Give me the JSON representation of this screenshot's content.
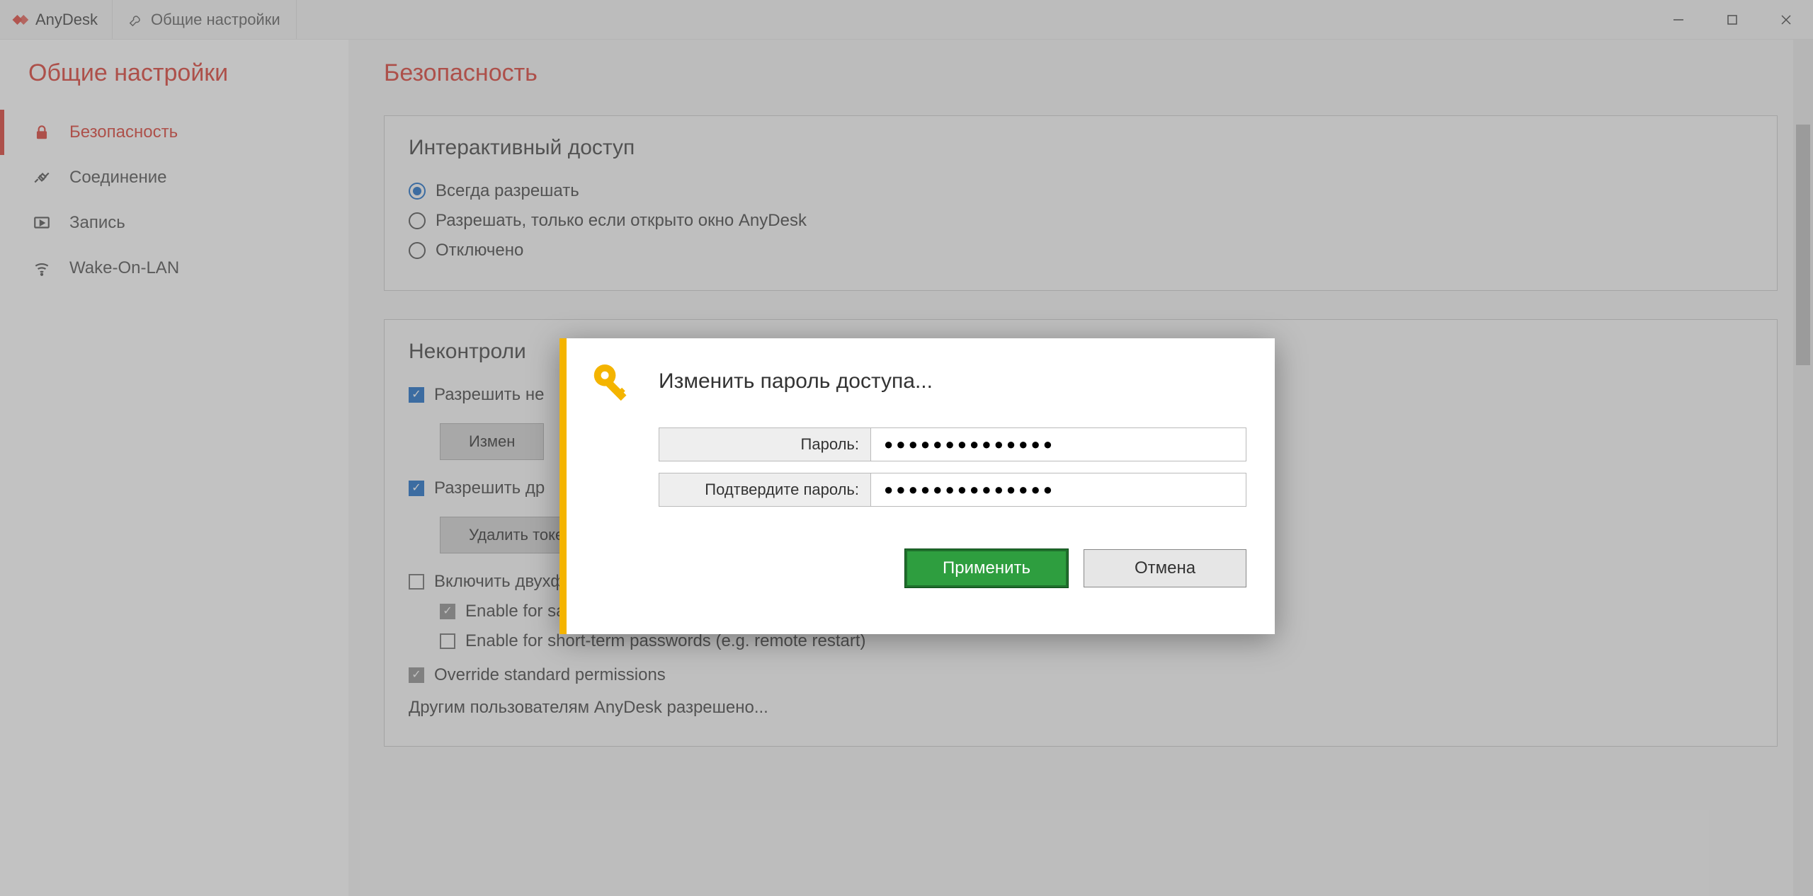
{
  "app_name": "AnyDesk",
  "tab_label": "Общие настройки",
  "sidebar": {
    "title": "Общие настройки",
    "items": [
      {
        "label": "Безопасность",
        "active": true
      },
      {
        "label": "Соединение"
      },
      {
        "label": "Запись"
      },
      {
        "label": "Wake-On-LAN"
      }
    ]
  },
  "page": {
    "title": "Безопасность",
    "interactive_access": {
      "heading": "Интерактивный доступ",
      "options": [
        {
          "label": "Всегда разрешать",
          "checked": true
        },
        {
          "label": "Разрешать, только если открыто окно AnyDesk",
          "checked": false
        },
        {
          "label": "Отключено",
          "checked": false
        }
      ]
    },
    "unattended": {
      "heading_partial": "Неконтроли",
      "allow_unattended_partial": "Разрешить не",
      "change_btn_partial": "Измен",
      "allow_other_partial": "Разрешить др",
      "delete_tokens_btn": "Удалить токены авторизации",
      "two_factor": "Включить двухфакторную аутентификацию",
      "enable_saved": "Enable for saved login information",
      "enable_short": "Enable for short-term passwords (e.g. remote restart)",
      "override": "Override standard permissions",
      "others_allowed": "Другим пользователям AnyDesk разрешено..."
    }
  },
  "dialog": {
    "title": "Изменить пароль доступа...",
    "password_label": "Пароль:",
    "confirm_label": "Подтвердите пароль:",
    "password_value": "●●●●●●●●●●●●●●",
    "confirm_value": "●●●●●●●●●●●●●●",
    "apply": "Применить",
    "cancel": "Отмена"
  }
}
